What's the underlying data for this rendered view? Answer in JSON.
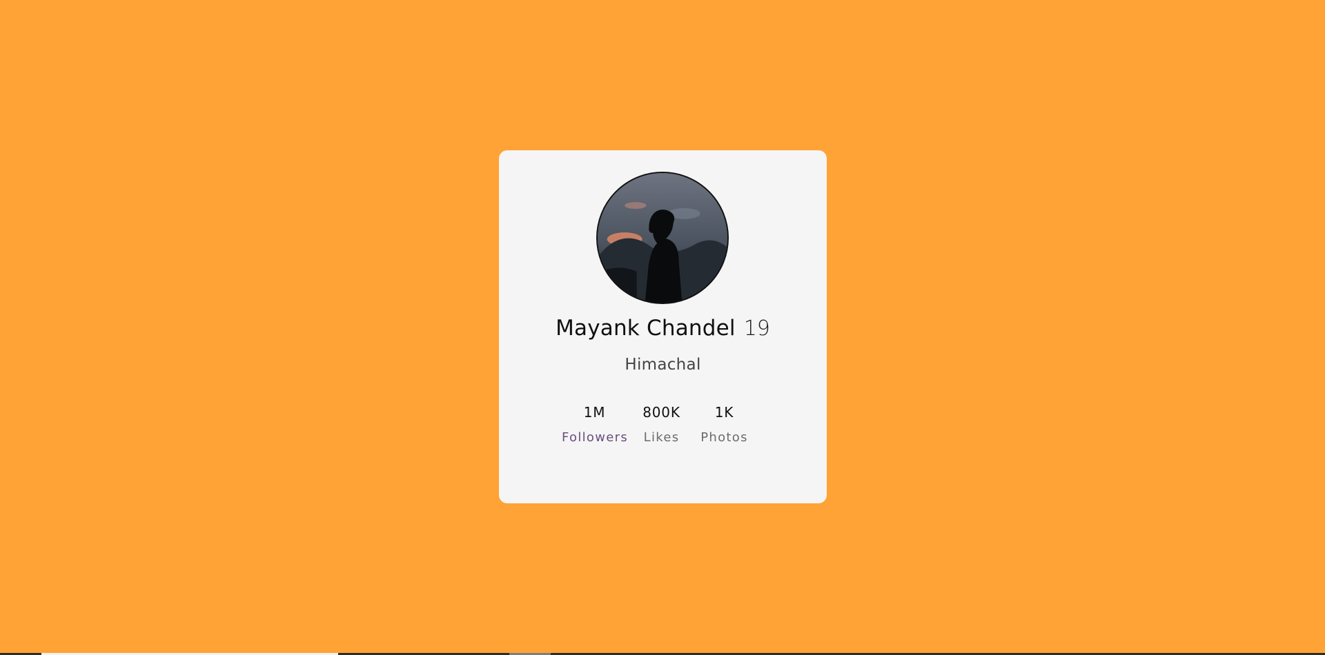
{
  "profile": {
    "name": "Mayank Chandel",
    "age": "19",
    "location": "Himachal"
  },
  "stats": [
    {
      "value": "1M",
      "label": "Followers"
    },
    {
      "value": "800K",
      "label": "Likes"
    },
    {
      "value": "1K",
      "label": "Photos"
    }
  ],
  "colors": {
    "background": "#ffa336",
    "card": "#f5f5f5",
    "text": "#101010",
    "muted": "#6b6b6b"
  }
}
